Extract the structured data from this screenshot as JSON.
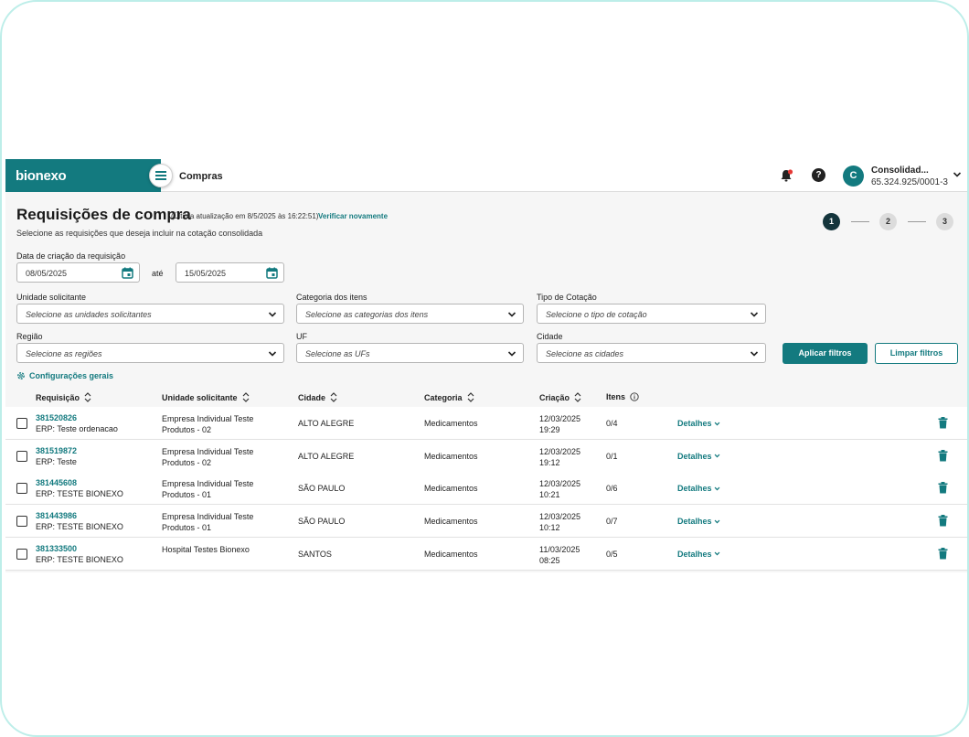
{
  "header": {
    "brand": "bionexo",
    "app_title": "Compras",
    "user_initial": "C",
    "user_name": "Consolidad...",
    "user_id": "65.324.925/0001-3",
    "help_label": "?"
  },
  "page": {
    "title": "Requisições de compra",
    "update_note": "(Última atualização em 8/5/2025 às 16:22:51)",
    "verify_link": "Verificar novamente",
    "subtitle": "Selecione as requisições que deseja incluir na cotação consolidada"
  },
  "stepper": [
    "1",
    "2",
    "3"
  ],
  "filters": {
    "date_label": "Data de criação da requisição",
    "date_from": "08/05/2025",
    "date_sep": "até",
    "date_to": "15/05/2025",
    "unidade_label": "Unidade solicitante",
    "unidade_placeholder": "Selecione as unidades solicitantes",
    "categoria_label": "Categoria dos itens",
    "categoria_placeholder": "Selecione as categorias dos itens",
    "tipo_label": "Tipo de Cotação",
    "tipo_placeholder": "Selecione o tipo de cotação",
    "regiao_label": "Região",
    "regiao_placeholder": "Selecione as regiões",
    "uf_label": "UF",
    "uf_placeholder": "Selecione as UFs",
    "cidade_label": "Cidade",
    "cidade_placeholder": "Selecione as cidades",
    "apply": "Aplicar filtros",
    "clear": "Limpar filtros",
    "config": "Configurações gerais"
  },
  "table": {
    "headers": [
      "Requisição",
      "Unidade solicitante",
      "Cidade",
      "Categoria",
      "Criação",
      "Itens"
    ],
    "details_label": "Detalhes",
    "rows": [
      {
        "id": "381520826",
        "erp": "ERP: Teste ordenacao",
        "unit_l1": "Empresa Individual Teste",
        "unit_l2": "Produtos - 02",
        "city": "ALTO ALEGRE",
        "category": "Medicamentos",
        "date": "12/03/2025",
        "time": "19:29",
        "items": "0/4"
      },
      {
        "id": "381519872",
        "erp": "ERP: Teste",
        "unit_l1": "Empresa Individual Teste",
        "unit_l2": "Produtos - 02",
        "city": "ALTO ALEGRE",
        "category": "Medicamentos",
        "date": "12/03/2025",
        "time": "19:12",
        "items": "0/1"
      },
      {
        "id": "381445608",
        "erp": "ERP: TESTE BIONEXO",
        "unit_l1": "Empresa Individual Teste",
        "unit_l2": "Produtos - 01",
        "city": "SÃO PAULO",
        "category": "Medicamentos",
        "date": "12/03/2025",
        "time": "10:21",
        "items": "0/6"
      },
      {
        "id": "381443986",
        "erp": "ERP: TESTE BIONEXO",
        "unit_l1": "Empresa Individual Teste",
        "unit_l2": "Produtos - 01",
        "city": "SÃO PAULO",
        "category": "Medicamentos",
        "date": "12/03/2025",
        "time": "10:12",
        "items": "0/7"
      },
      {
        "id": "381333500",
        "erp": "ERP: TESTE BIONEXO",
        "unit_l1": "Hospital Testes Bionexo",
        "unit_l2": "",
        "city": "SANTOS",
        "category": "Medicamentos",
        "date": "11/03/2025",
        "time": "08:25",
        "items": "0/5"
      }
    ]
  },
  "colors": {
    "brand": "#137a7f",
    "step_active": "#14353c",
    "notification_dot": "#e53935"
  }
}
